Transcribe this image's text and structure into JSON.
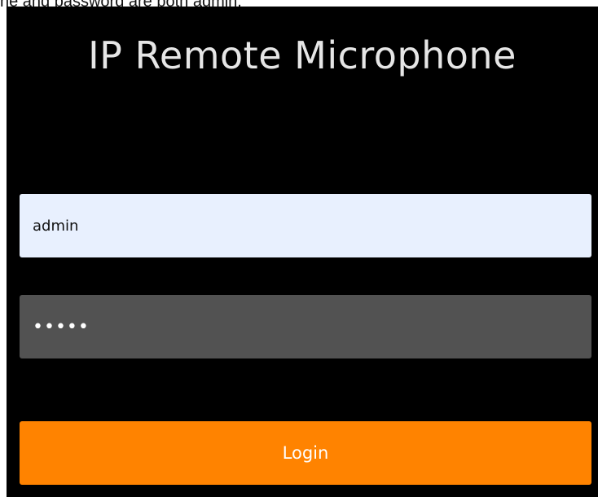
{
  "caption": "ne and password are both admin.",
  "login": {
    "title": "IP Remote Microphone",
    "username_value": "admin",
    "password_value": "admin",
    "button_label": "Login"
  },
  "colors": {
    "panel_background": "#000000",
    "username_background": "#e8f0fe",
    "password_background": "#525252",
    "button_background": "#ff8300",
    "button_text": "#ffffff"
  }
}
